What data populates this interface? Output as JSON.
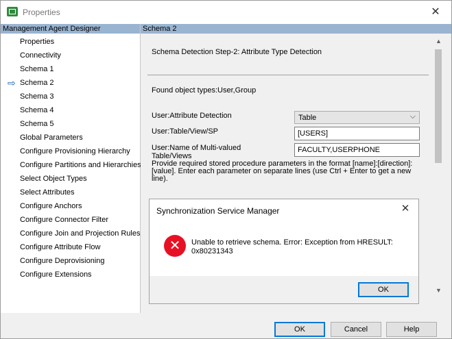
{
  "window": {
    "title": "Properties"
  },
  "left_panel": {
    "header": "Management Agent Designer",
    "items": [
      {
        "label": "Properties",
        "active": false
      },
      {
        "label": "Connectivity",
        "active": false
      },
      {
        "label": "Schema 1",
        "active": false
      },
      {
        "label": "Schema 2",
        "active": true
      },
      {
        "label": "Schema 3",
        "active": false
      },
      {
        "label": "Schema 4",
        "active": false
      },
      {
        "label": "Schema 5",
        "active": false
      },
      {
        "label": "Global Parameters",
        "active": false
      },
      {
        "label": "Configure Provisioning Hierarchy",
        "active": false
      },
      {
        "label": "Configure Partitions and Hierarchies",
        "active": false
      },
      {
        "label": "Select Object Types",
        "active": false
      },
      {
        "label": "Select Attributes",
        "active": false
      },
      {
        "label": "Configure Anchors",
        "active": false
      },
      {
        "label": "Configure Connector Filter",
        "active": false
      },
      {
        "label": "Configure Join and Projection Rules",
        "active": false
      },
      {
        "label": "Configure Attribute Flow",
        "active": false
      },
      {
        "label": "Configure Deprovisioning",
        "active": false
      },
      {
        "label": "Configure Extensions",
        "active": false
      }
    ]
  },
  "right_panel": {
    "header": "Schema 2",
    "step_title": "Schema Detection Step-2: Attribute Type Detection",
    "found_types": "Found object types:User,Group",
    "fields": {
      "attr_detection": {
        "label": "User:Attribute Detection",
        "value": "Table"
      },
      "table_view_sp": {
        "label": "User:Table/View/SP",
        "value": "[USERS]"
      },
      "multi_valued": {
        "label_line1": "User:Name of Multi-valued",
        "label_line2": "Table/Views",
        "value": "FACULTY,USERPHONE"
      }
    },
    "help_text": "Provide required stored procedure parameters in the format [name]:[direction]:[value]. Enter each parameter on separate lines (use Ctrl + Enter to get a new line)."
  },
  "dialog": {
    "title": "Synchronization Service Manager",
    "message": "Unable to retrieve schema. Error: Exception from HRESULT: 0x80231343",
    "ok_label": "OK",
    "close_glyph": "✕",
    "icon_glyph": "✕",
    "icon_color": "#e81123"
  },
  "footer": {
    "ok_label": "OK",
    "cancel_label": "Cancel",
    "help_label": "Help"
  },
  "glyphs": {
    "close": "✕",
    "nav_arrow": "⇨",
    "chevron": "⌵",
    "scroll_up": "▲",
    "scroll_down": "▼"
  },
  "colors": {
    "panel_header": "#99b4d1",
    "focus_border": "#0078d7"
  }
}
